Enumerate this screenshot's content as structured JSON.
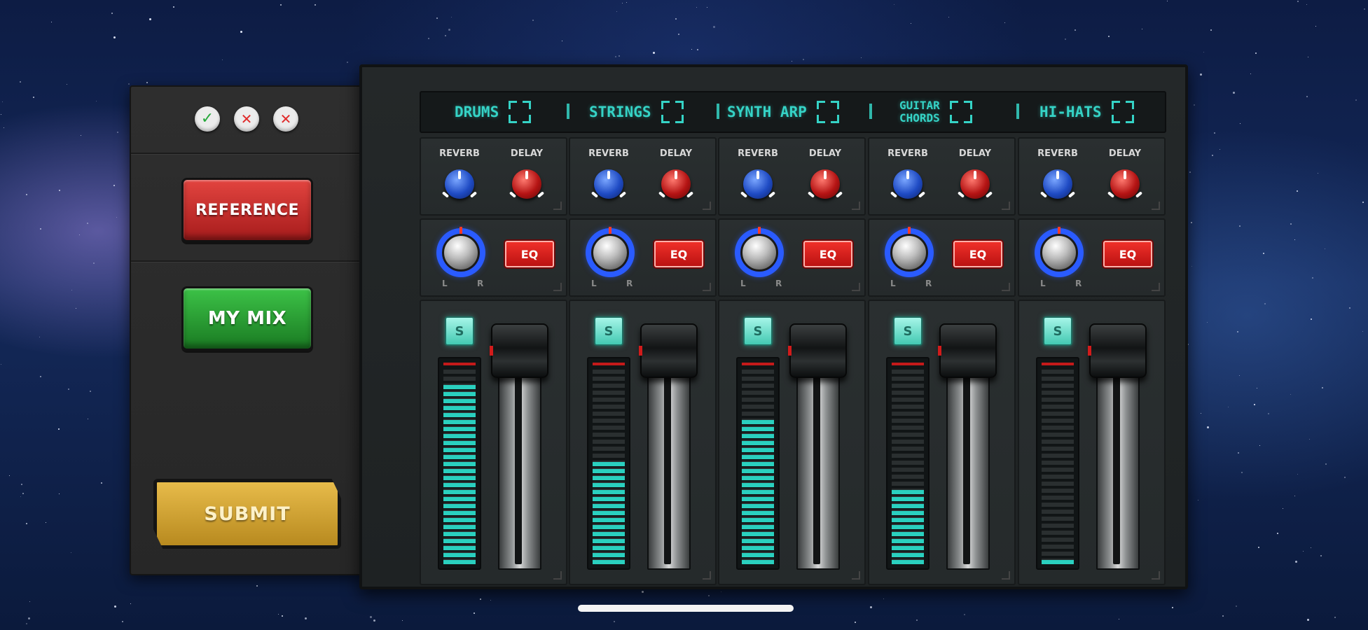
{
  "status_icons": [
    "check-icon",
    "cross-icon",
    "cross-icon"
  ],
  "buttons": {
    "reference": "REFERENCE",
    "my_mix": "MY MIX",
    "submit": "SUBMIT"
  },
  "colors": {
    "track_text": "#35d3c6",
    "meter_lit": "#2ad0bf",
    "reverb_knob": "#1f4bc4",
    "delay_knob": "#b51414",
    "pan_ring": "#2a5bff",
    "eq_button": "#e02a24",
    "reference_button": "#c62f2b",
    "my_mix_button": "#2a9c33",
    "submit_button": "#d6a633"
  },
  "channels": [
    {
      "name": "DRUMS",
      "reverb": "REVERB",
      "delay": "DELAY",
      "eq": "EQ",
      "solo": "S",
      "pan_left": "L",
      "pan_right": "R",
      "meter_level": 0.95,
      "fader_level": 1.0
    },
    {
      "name": "STRINGS",
      "reverb": "REVERB",
      "delay": "DELAY",
      "eq": "EQ",
      "solo": "S",
      "pan_left": "L",
      "pan_right": "R",
      "meter_level": 0.56,
      "fader_level": 1.0
    },
    {
      "name": "SYNTH ARP",
      "reverb": "REVERB",
      "delay": "DELAY",
      "eq": "EQ",
      "solo": "S",
      "pan_left": "L",
      "pan_right": "R",
      "meter_level": 0.78,
      "fader_level": 1.0
    },
    {
      "name": "GUITAR CHORDS",
      "name_line1": "GUITAR",
      "name_line2": "CHORDS",
      "reverb": "REVERB",
      "delay": "DELAY",
      "eq": "EQ",
      "solo": "S",
      "pan_left": "L",
      "pan_right": "R",
      "meter_level": 0.4,
      "fader_level": 1.0
    },
    {
      "name": "HI-HATS",
      "reverb": "REVERB",
      "delay": "DELAY",
      "eq": "EQ",
      "solo": "S",
      "pan_left": "L",
      "pan_right": "R",
      "meter_level": 0.03,
      "fader_level": 1.0
    }
  ]
}
